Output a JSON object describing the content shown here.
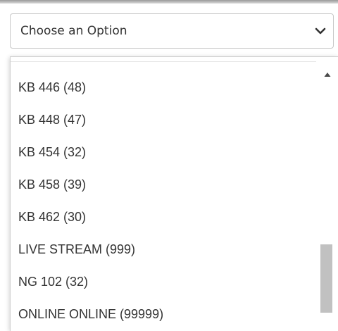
{
  "select": {
    "placeholder": "Choose an Option"
  },
  "options": [
    "KB 446 (48)",
    "KB 448 (47)",
    "KB 454 (32)",
    "KB 458 (39)",
    "KB 462 (30)",
    "LIVE STREAM (999)",
    "NG 102 (32)",
    "ONLINE ONLINE (99999)"
  ],
  "icons": {
    "dropdown_toggle": "chevron-down-icon",
    "scroll_up": "triangle-up-icon"
  },
  "colors": {
    "text": "#333333",
    "border": "#c8c8c8",
    "scroll_thumb": "#c1c1c1"
  }
}
